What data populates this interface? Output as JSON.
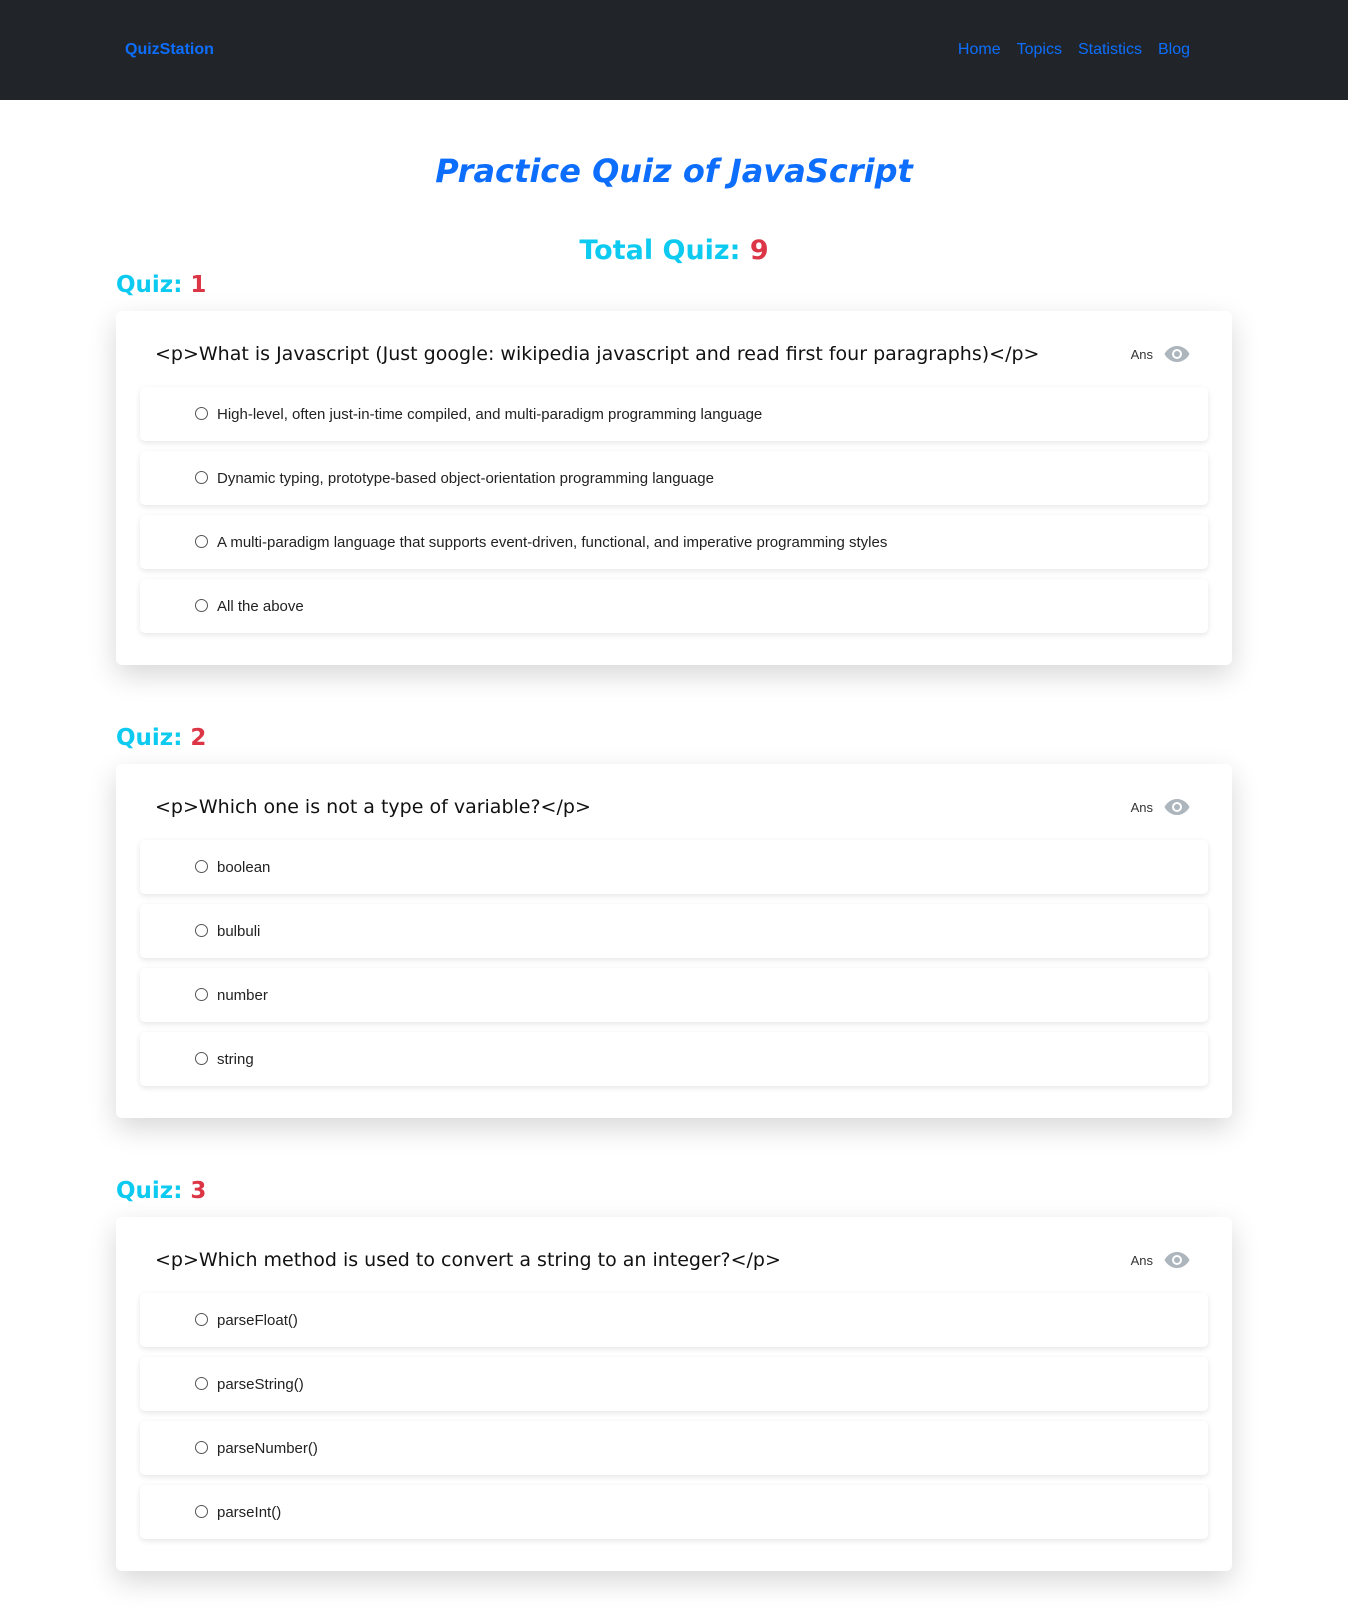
{
  "navbar": {
    "brand": "QuizStation",
    "links": [
      "Home",
      "Topics",
      "Statistics",
      "Blog"
    ]
  },
  "page": {
    "title": "Practice Quiz of JavaScript",
    "total_label": "Total Quiz:",
    "total_value": "9"
  },
  "quiz_label": "Quiz:",
  "ans_label": "Ans",
  "quizzes": [
    {
      "number": "1",
      "question": "<p>What is Javascript (Just google: wikipedia javascript and read first four paragraphs)</p>",
      "options": [
        "High-level, often just-in-time compiled, and multi-paradigm programming language",
        "Dynamic typing, prototype-based object-orientation programming language",
        "A multi-paradigm language that supports event-driven, functional, and imperative programming styles",
        "All the above"
      ]
    },
    {
      "number": "2",
      "question": "<p>Which one is not a type of variable?</p>",
      "options": [
        "boolean",
        "bulbuli",
        "number",
        "string"
      ]
    },
    {
      "number": "3",
      "question": "<p>Which method is used to convert a string to an integer?</p>",
      "options": [
        "parseFloat()",
        "parseString()",
        "parseNumber()",
        "parseInt()"
      ]
    }
  ],
  "colors": {
    "navbar_bg": "#212529",
    "link": "#0d6efd",
    "cyan": "#0dcaf0",
    "red": "#dc3545",
    "eye": "#adb5bd"
  }
}
